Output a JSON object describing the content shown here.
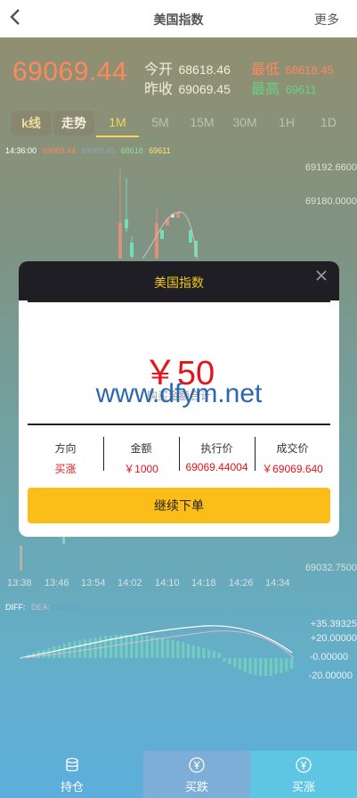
{
  "header": {
    "title": "美国指数",
    "more": "更多"
  },
  "quote": {
    "price": "69069.44",
    "open_label": "今开",
    "open_value": "68618.46",
    "prev_label": "昨收",
    "prev_value": "69069.45",
    "low_label": "最低",
    "low_value": "68618.45",
    "high_label": "最高",
    "high_value": "69611"
  },
  "tabs": [
    {
      "label": "k线"
    },
    {
      "label": "走势"
    },
    {
      "label": "1M"
    },
    {
      "label": "5M"
    },
    {
      "label": "15M"
    },
    {
      "label": "30M"
    },
    {
      "label": "1H"
    },
    {
      "label": "1D"
    }
  ],
  "ohlc": {
    "time": "14:36:00",
    "v1": "69069.44",
    "v2": "69069.45",
    "v3": "68618",
    "v4": "69611"
  },
  "chart": {
    "y_labels": [
      "69192.6600",
      "69180.0000",
      "69032.7500"
    ],
    "x_labels": [
      "13:38",
      "13:46",
      "13:54",
      "14:02",
      "14:10",
      "14:18",
      "14:26",
      "14:34"
    ]
  },
  "indicator": {
    "diff": "DIFF:",
    "dea": "DEA:",
    "macd": "MACD:"
  },
  "macd": {
    "labels": [
      "+35.39325",
      "+20.00000",
      "-0.00000",
      "-20.00000"
    ]
  },
  "modal": {
    "title": "美国指数",
    "amount": "￥50",
    "subtext": "购买金额合计",
    "watermark": "www.dfym.net",
    "info": [
      {
        "key": "方向",
        "value": "买涨"
      },
      {
        "key": "金额",
        "value": "￥1000"
      },
      {
        "key": "执行价",
        "value": "69069.44004"
      },
      {
        "key": "成交价",
        "value": "￥69069.640"
      }
    ],
    "continue_label": "继续下单"
  },
  "nav": [
    {
      "label": "持仓",
      "icon": "coins-icon"
    },
    {
      "label": "买跌",
      "icon": "yen-icon"
    },
    {
      "label": "买涨",
      "icon": "yen-icon"
    }
  ],
  "colors": {
    "up": "#ff5a1f",
    "down": "#3fcf9a",
    "accent": "#f5c518",
    "modal_red": "#e4141a"
  }
}
